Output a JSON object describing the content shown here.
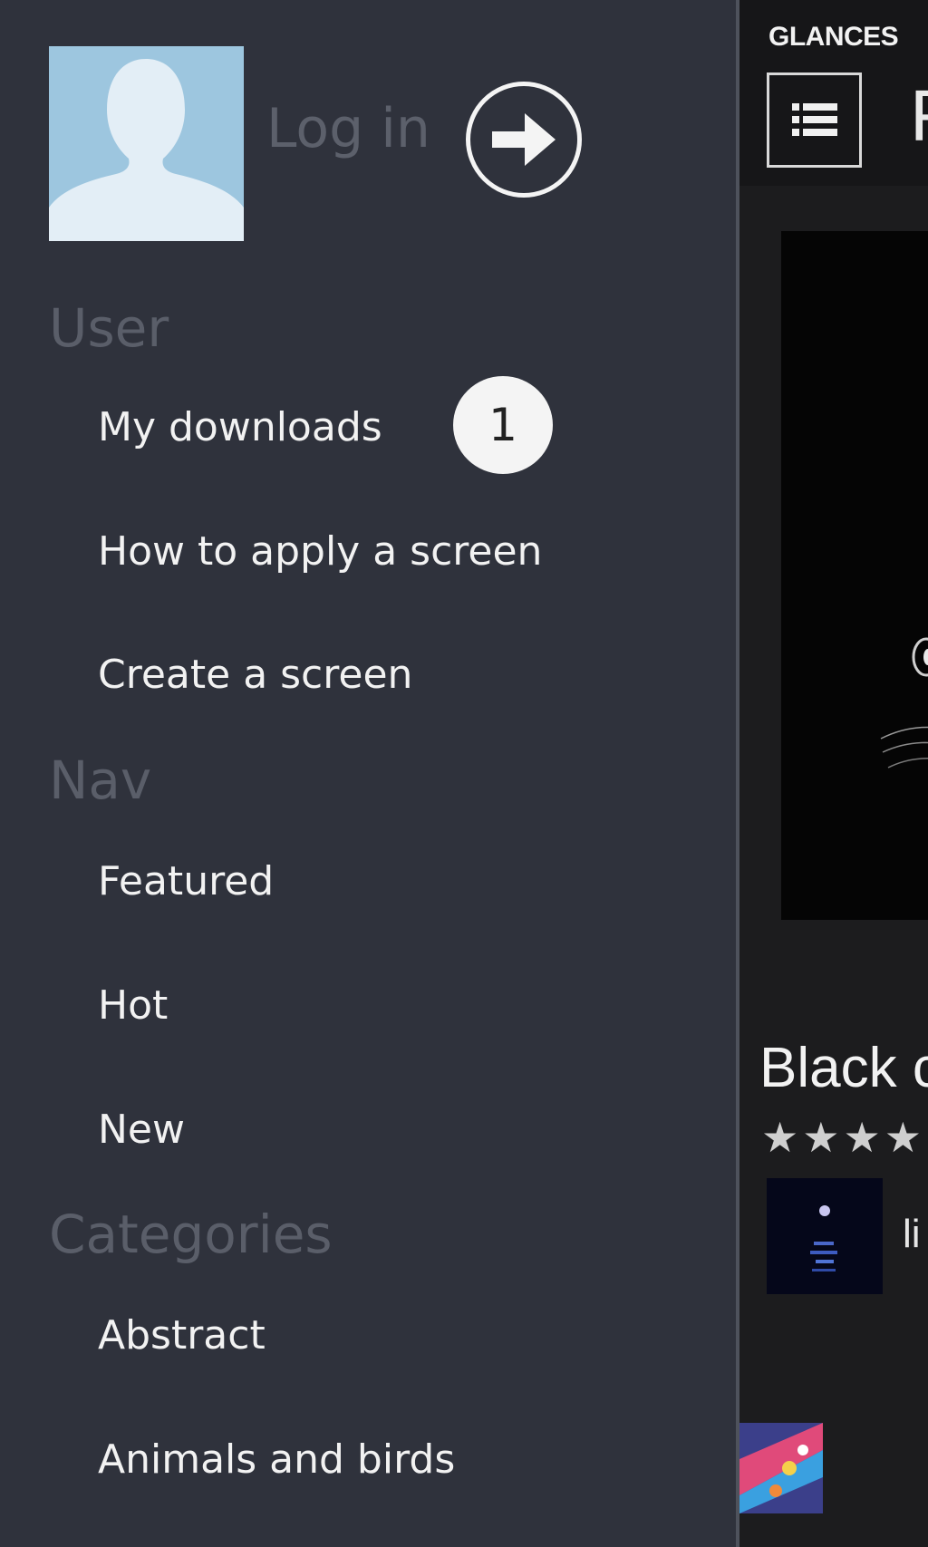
{
  "drawer": {
    "login_label": "Log in",
    "sections": {
      "user": {
        "header": "User",
        "items": [
          {
            "label": "My downloads",
            "badge": "1"
          },
          {
            "label": "How to apply a screen"
          },
          {
            "label": "Create a screen"
          }
        ]
      },
      "nav": {
        "header": "Nav",
        "items": [
          {
            "label": "Featured"
          },
          {
            "label": "Hot"
          },
          {
            "label": "New"
          }
        ]
      },
      "categories": {
        "header": "Categories",
        "items": [
          {
            "label": "Abstract"
          },
          {
            "label": "Animals and birds"
          }
        ]
      }
    },
    "colors": {
      "background": "#2f323c",
      "avatar": "#9dc6df",
      "header_text": "#5a5e69",
      "item_text": "#f2f2f2"
    }
  },
  "panel": {
    "app_name": "GLANCES",
    "page_title": "F",
    "screen_title": "Black c",
    "rating_text": "★★★★",
    "author_name": "li"
  },
  "icons": {
    "avatar": "person-silhouette-icon",
    "login": "arrow-right-circle-icon",
    "menu": "list-icon"
  }
}
